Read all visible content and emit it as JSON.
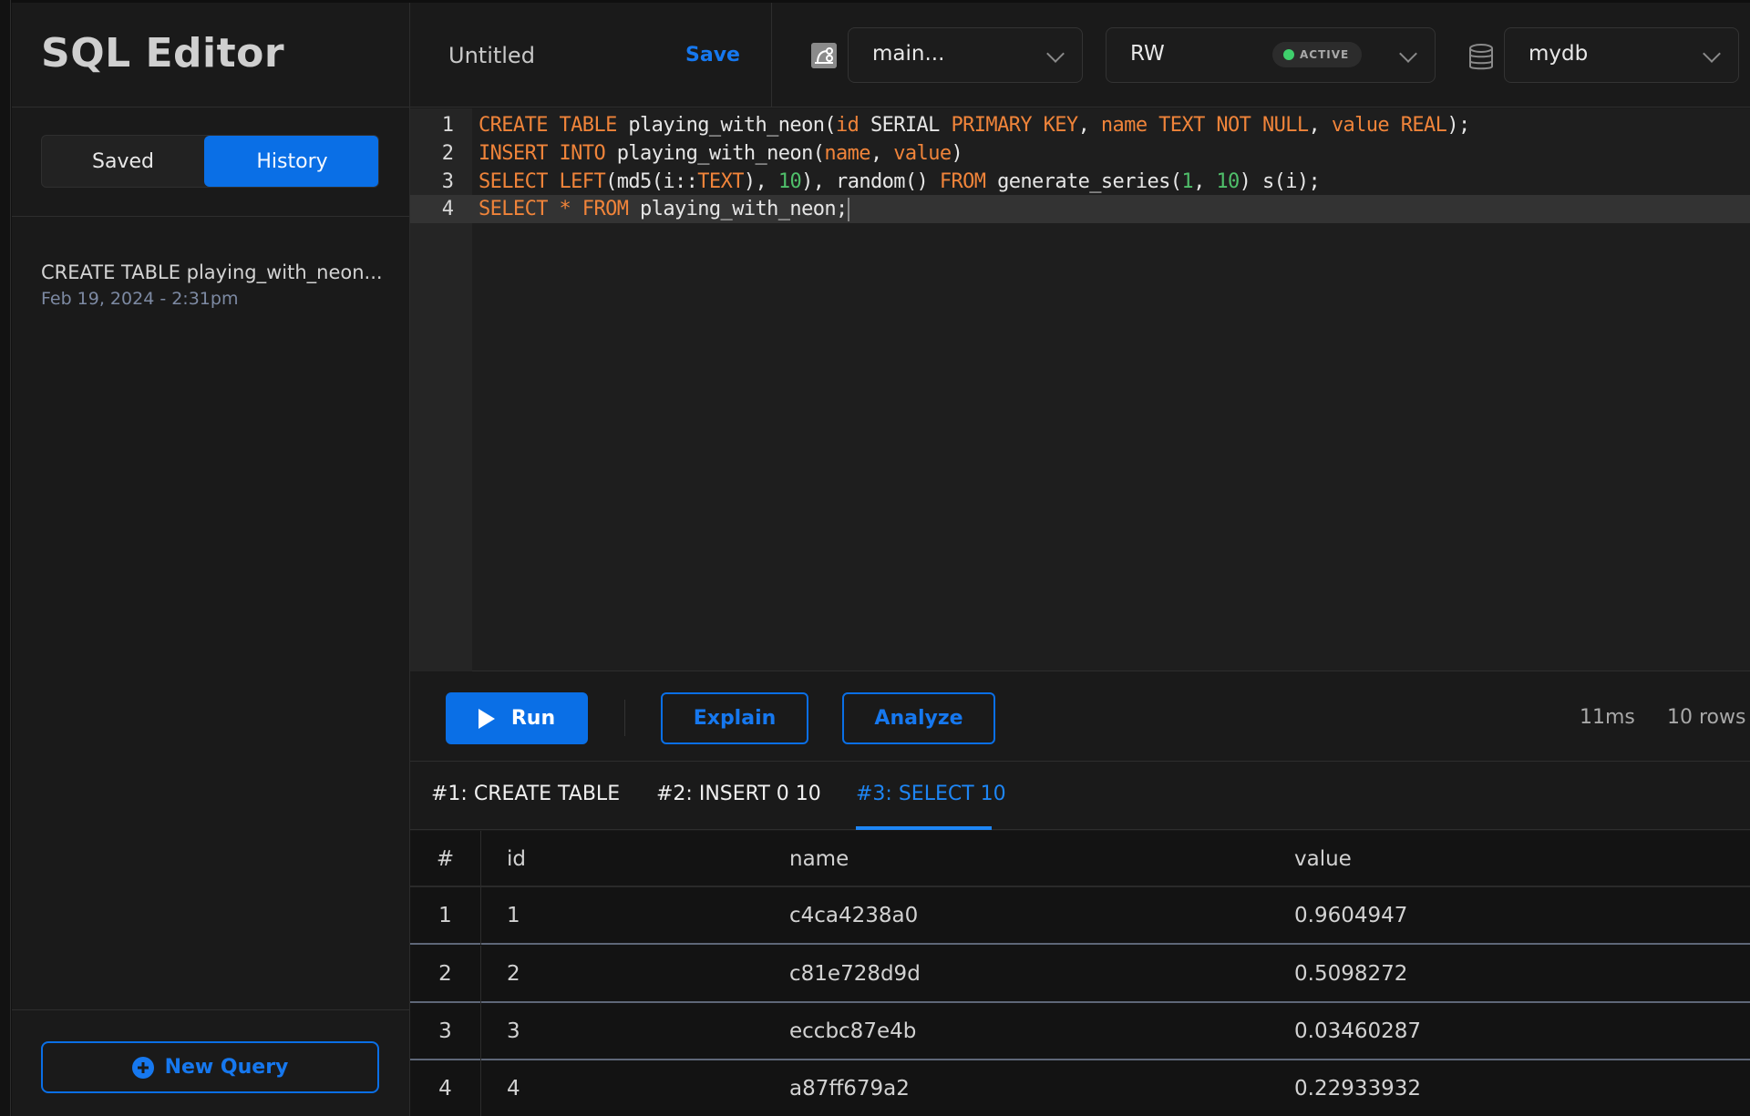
{
  "sidebar": {
    "title": "SQL Editor",
    "tabs": [
      {
        "label": "Saved",
        "active": false
      },
      {
        "label": "History",
        "active": true
      }
    ],
    "history": [
      {
        "title": "CREATE TABLE playing_with_neon...",
        "date": "Feb 19, 2024 - 2:31pm"
      }
    ],
    "new_query_label": "New Query"
  },
  "topbar": {
    "doc_title": "Untitled",
    "save_label": "Save",
    "branch": {
      "icon": "branch-icon",
      "value": "main..."
    },
    "compute": {
      "value": "RW",
      "status": "ACTIVE",
      "status_color": "#3fcf6c"
    },
    "database": {
      "icon": "database-icon",
      "value": "mydb"
    }
  },
  "editor": {
    "lines": [
      {
        "n": "1",
        "tokens": [
          [
            "kw",
            "CREATE TABLE"
          ],
          [
            "t",
            " playing_with_neon("
          ],
          [
            "kw",
            "id"
          ],
          [
            "t",
            " SERIAL "
          ],
          [
            "kw",
            "PRIMARY KEY"
          ],
          [
            "t",
            ", "
          ],
          [
            "kw",
            "name"
          ],
          [
            "t",
            " "
          ],
          [
            "kw",
            "TEXT NOT NULL"
          ],
          [
            "t",
            ", "
          ],
          [
            "kw",
            "value"
          ],
          [
            "t",
            " "
          ],
          [
            "kw",
            "REAL"
          ],
          [
            "t",
            ");"
          ]
        ]
      },
      {
        "n": "2",
        "tokens": [
          [
            "kw",
            "INSERT INTO"
          ],
          [
            "t",
            " playing_with_neon("
          ],
          [
            "kw",
            "name"
          ],
          [
            "t",
            ", "
          ],
          [
            "kw",
            "value"
          ],
          [
            "t",
            ")"
          ]
        ]
      },
      {
        "n": "3",
        "tokens": [
          [
            "kw",
            "SELECT LEFT"
          ],
          [
            "t",
            "(md5(i::"
          ],
          [
            "kw",
            "TEXT"
          ],
          [
            "t",
            "), "
          ],
          [
            "num",
            "10"
          ],
          [
            "t",
            "), random() "
          ],
          [
            "kw",
            "FROM"
          ],
          [
            "t",
            " generate_series("
          ],
          [
            "num",
            "1"
          ],
          [
            "t",
            ", "
          ],
          [
            "num",
            "10"
          ],
          [
            "t",
            ") s(i);"
          ]
        ]
      },
      {
        "n": "4",
        "tokens": [
          [
            "kw",
            "SELECT * FROM"
          ],
          [
            "t",
            " playing_with_neon;"
          ]
        ],
        "current": true
      }
    ]
  },
  "toolbar": {
    "run_label": "Run",
    "explain_label": "Explain",
    "analyze_label": "Analyze",
    "duration": "11ms",
    "row_count": "10 rows"
  },
  "results": {
    "tabs": [
      {
        "label": "#1: CREATE TABLE",
        "active": false
      },
      {
        "label": "#2: INSERT 0 10",
        "active": false
      },
      {
        "label": "#3: SELECT 10",
        "active": true
      }
    ],
    "columns": [
      "#",
      "id",
      "name",
      "value"
    ],
    "rows": [
      [
        "1",
        "1",
        "c4ca4238a0",
        "0.9604947"
      ],
      [
        "2",
        "2",
        "c81e728d9d",
        "0.5098272"
      ],
      [
        "3",
        "3",
        "eccbc87e4b",
        "0.03460287"
      ],
      [
        "4",
        "4",
        "a87ff679a2",
        "0.22933932"
      ]
    ]
  },
  "colors": {
    "accent": "#0a6fe6",
    "keyword": "#f0843a",
    "number": "#4fbf6a"
  }
}
